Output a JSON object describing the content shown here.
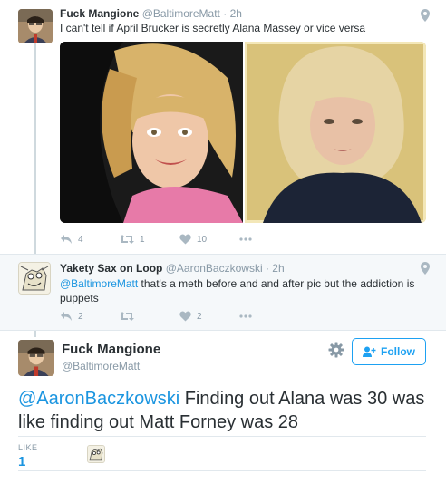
{
  "tweet": {
    "author_name": "Fuck Mangione",
    "author_handle": "@BaltimoreMatt",
    "time": "2h",
    "text": "I can't tell if April Brucker is secretly Alana Massey or vice versa",
    "reply_count": "4",
    "retweet_count": "1",
    "like_count": "10"
  },
  "reply": {
    "author_name": "Yakety Sax on Loop",
    "author_handle": "@AaronBaczkowski",
    "time": "2h",
    "mention": "@BaltimoreMatt",
    "text": " that's a meth before and and after pic but the addiction is puppets",
    "reply_count": "2",
    "like_count": "2"
  },
  "main": {
    "author_name": "Fuck Mangione",
    "author_handle": "@BaltimoreMatt",
    "follow_label": "Follow",
    "mention": "@AaronBaczkowski",
    "text": " Finding out Alana was 30 was like finding out Matt Forney was 28",
    "likes_label": "LIKE",
    "likes_count": "1"
  },
  "separator": " · ",
  "colors": {
    "accent": "#1da1f2",
    "link": "#1b95e0",
    "muted": "#8899a6",
    "text": "#292f33",
    "reply_bg": "#f5f8fa"
  },
  "icons": [
    "location-pin-icon",
    "reply-icon",
    "retweet-icon",
    "heart-icon",
    "more-icon",
    "gear-icon",
    "follow-person-icon"
  ]
}
